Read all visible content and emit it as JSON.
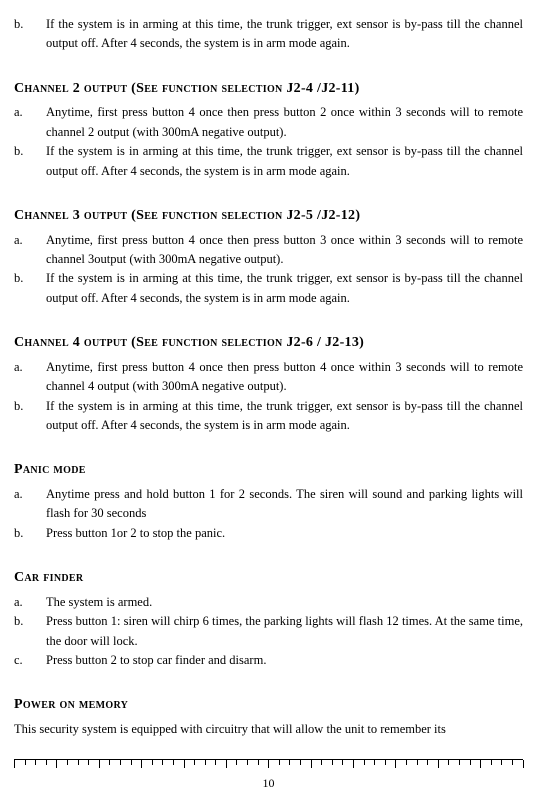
{
  "top_item": {
    "marker": "b.",
    "text": "If the system is in arming at this time, the trunk trigger, ext sensor is by-pass till the channel output off. After 4 seconds, the system is in arm mode again."
  },
  "ch2": {
    "heading": "Channel 2 output (See function selection J2-4 /J2-11)",
    "items": [
      {
        "marker": "a.",
        "text": "Anytime, first press button 4 once then press button 2 once within 3 seconds will to remote channel 2 output (with 300mA negative output)."
      },
      {
        "marker": "b.",
        "text": "If the system is in arming at this time, the trunk trigger, ext sensor is by-pass till the channel output off. After 4 seconds, the system is in arm mode again."
      }
    ]
  },
  "ch3": {
    "heading": "Channel 3 output (See function selection J2-5 /J2-12)",
    "items": [
      {
        "marker": "a.",
        "text": "Anytime, first press button 4 once then press button 3 once within 3 seconds will to remote channel 3output (with 300mA negative output)."
      },
      {
        "marker": "b.",
        "text": "If the system is in arming at this time, the trunk trigger, ext sensor is by-pass till the channel output off. After 4 seconds, the system is in arm mode again."
      }
    ]
  },
  "ch4": {
    "heading": "Channel 4 output (See function selection J2-6 / J2-13)",
    "items": [
      {
        "marker": "a.",
        "text": "Anytime, first press button 4 once then press button 4 once within 3 seconds will to remote channel 4 output (with 300mA negative output)."
      },
      {
        "marker": "b.",
        "text": "If the system is in arming at this time, the trunk trigger, ext sensor is by-pass till the channel output off. After 4 seconds, the system is in arm mode again."
      }
    ]
  },
  "panic": {
    "heading": "Panic mode",
    "items": [
      {
        "marker": "a.",
        "text": "Anytime press and hold button 1 for 2 seconds. The siren will sound and parking lights will flash for 30 seconds"
      },
      {
        "marker": "b.",
        "text": "Press button 1or 2 to stop the panic."
      }
    ]
  },
  "carfinder": {
    "heading": "Car finder",
    "items": [
      {
        "marker": "a.",
        "text": "The system is armed."
      },
      {
        "marker": "b.",
        "text": "Press button 1: siren will chirp 6 times, the parking lights will flash 12 times. At the same time, the door will lock."
      },
      {
        "marker": "c.",
        "text": "Press button 2 to stop car finder and disarm."
      }
    ]
  },
  "power": {
    "heading": "Power on memory",
    "text": "This security system is equipped with circuitry that will allow the unit to remember its"
  },
  "pagenum": "10"
}
